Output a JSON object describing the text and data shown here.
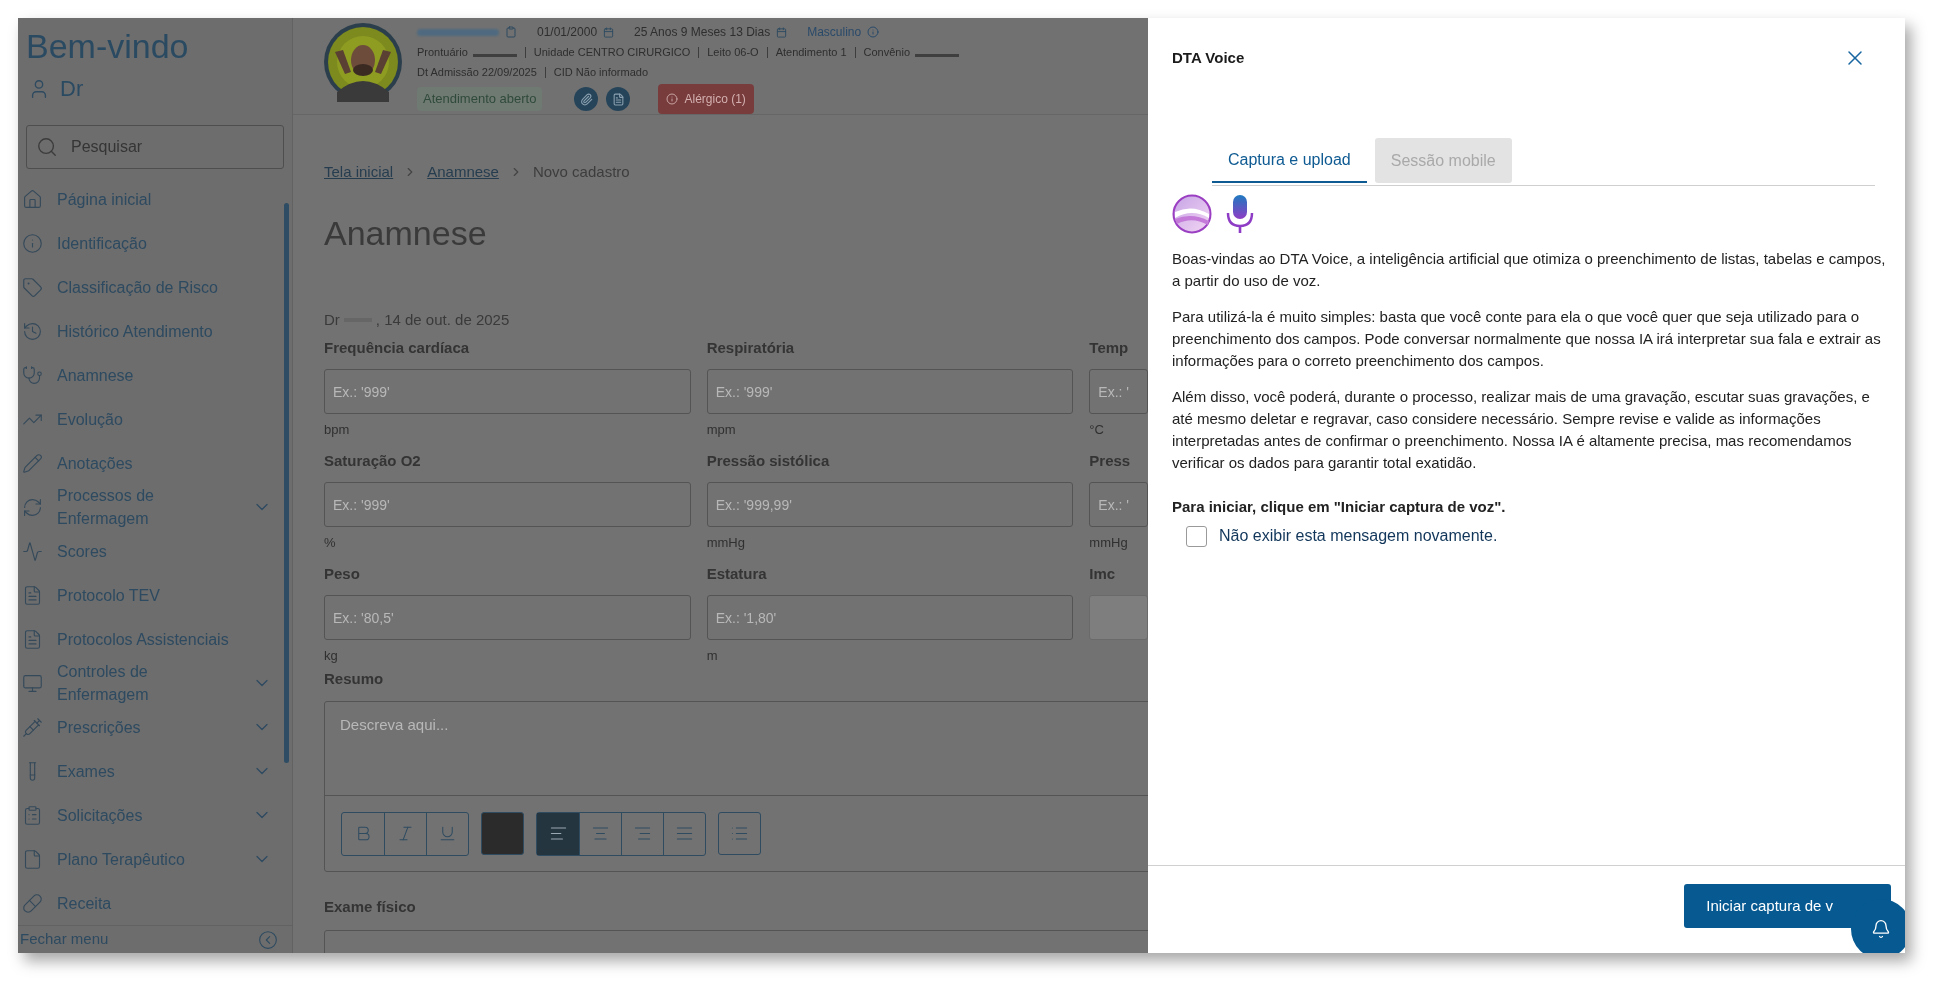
{
  "sidebar": {
    "title": "Bem-vindo",
    "user": "Dr",
    "search": {
      "placeholder": "Pesquisar"
    },
    "items": [
      {
        "label": "Página inicial",
        "expandable": false
      },
      {
        "label": "Identificação",
        "expandable": false
      },
      {
        "label": "Classificação de Risco",
        "expandable": false
      },
      {
        "label": "Histórico Atendimento",
        "expandable": false
      },
      {
        "label": "Anamnese",
        "expandable": false
      },
      {
        "label": "Evolução",
        "expandable": false
      },
      {
        "label": "Anotações",
        "expandable": false
      },
      {
        "label": "Processos de Enfermagem",
        "expandable": true
      },
      {
        "label": "Scores",
        "expandable": false
      },
      {
        "label": "Protocolo TEV",
        "expandable": false
      },
      {
        "label": "Protocolos Assistenciais",
        "expandable": false
      },
      {
        "label": "Controles de Enfermagem",
        "expandable": true
      },
      {
        "label": "Prescrições",
        "expandable": true
      },
      {
        "label": "Exames",
        "expandable": true
      },
      {
        "label": "Solicitações",
        "expandable": true
      },
      {
        "label": "Plano Terapêutico",
        "expandable": true
      },
      {
        "label": "Receita",
        "expandable": false
      }
    ],
    "footer": "Fechar menu"
  },
  "patient": {
    "birth_date": "01/01/2000",
    "age": "25 Anos 9 Meses 13 Dias",
    "sex": "Masculino",
    "details": [
      "Prontuário",
      "Unidade CENTRO CIRURGICO",
      "Leito 06-O",
      "Atendimento 1",
      "Convênio"
    ],
    "admission": [
      "Dt Admissão 22/09/2025",
      "CID Não informado"
    ],
    "status": "Atendimento aberto",
    "allergy": "Alérgico (1)"
  },
  "breadcrumb": [
    {
      "label": "Tela inicial",
      "link": true
    },
    {
      "label": "Anamnese",
      "link": true
    },
    {
      "label": "Novo cadastro",
      "link": false
    }
  ],
  "page_title": "Anamnese",
  "author": {
    "prefix": "Dr",
    "date": ", 14 de out. de 2025"
  },
  "fields": [
    {
      "label": "Frequência cardíaca",
      "placeholder": "Ex.: '999'",
      "unit": "bpm",
      "disabled": false
    },
    {
      "label": "Respiratória",
      "placeholder": "Ex.: '999'",
      "unit": "mpm",
      "disabled": false
    },
    {
      "label": "Temp",
      "placeholder": "Ex.: '",
      "unit": "°C",
      "disabled": false
    },
    {
      "label": "Saturação O2",
      "placeholder": "Ex.: '999'",
      "unit": "%",
      "disabled": false
    },
    {
      "label": "Pressão sistólica",
      "placeholder": "Ex.: '999,99'",
      "unit": "mmHg",
      "disabled": false
    },
    {
      "label": "Press",
      "placeholder": "Ex.: '",
      "unit": "mmHg",
      "disabled": false
    },
    {
      "label": "Peso",
      "placeholder": "Ex.: '80,5'",
      "unit": "kg",
      "disabled": false
    },
    {
      "label": "Estatura",
      "placeholder": "Ex.: '1,80'",
      "unit": "m",
      "disabled": false
    },
    {
      "label": "Imc",
      "disabled": true
    }
  ],
  "summary": {
    "label": "Resumo",
    "placeholder": "Descreva aqui...",
    "align": [
      {
        "kind": "left",
        "selected": true
      },
      {
        "kind": "center",
        "selected": false
      },
      {
        "kind": "right",
        "selected": false
      },
      {
        "kind": "justify",
        "selected": false
      }
    ]
  },
  "exam_label": "Exame físico",
  "dialog": {
    "title": "DTA Voice",
    "tabs": [
      {
        "label": "Captura e upload",
        "selected": true,
        "disabled": false
      },
      {
        "label": "Sessão mobile",
        "selected": false,
        "disabled": true
      }
    ],
    "paragraphs": [
      "Boas-vindas ao DTA Voice, a inteligência artificial que otimiza o preenchimento de listas, tabelas e campos, a partir do uso de voz.",
      "Para utilizá-la é muito simples: basta que você conte para ela o que você quer que seja utilizado para o preenchimento dos campos. Pode conversar normalmente que nossa IA irá interpretar sua fala e extrair as informações para o correto preenchimento dos campos.",
      "Além disso, você poderá, durante o processo, realizar mais de uma gravação, escutar suas gravações, e até mesmo deletar e regravar, caso considere necessário. Sempre revise e valide as informações interpretadas antes de confirmar o preenchimento. Nossa IA é altamente precisa, mas recomendamos verificar os dados para garantir total exatidão."
    ],
    "instruction": "Para iniciar, clique em \"Iniciar captura de voz\".",
    "checkbox": {
      "label": "Não exibir esta mensagem novamente.",
      "checked": false
    },
    "button": "Iniciar captura de v"
  }
}
